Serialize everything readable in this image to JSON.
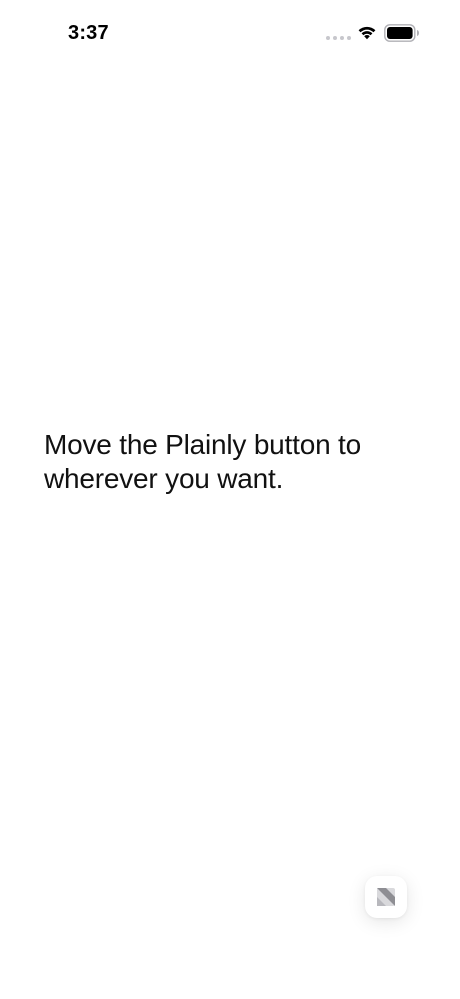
{
  "status_bar": {
    "time": "3:37",
    "icons": [
      "signal-dots-icon",
      "wifi-icon",
      "battery-icon"
    ]
  },
  "main": {
    "headline": "Move the Plainly button to wherever you want."
  },
  "floating_button": {
    "icon": "plainly-logo-icon"
  }
}
